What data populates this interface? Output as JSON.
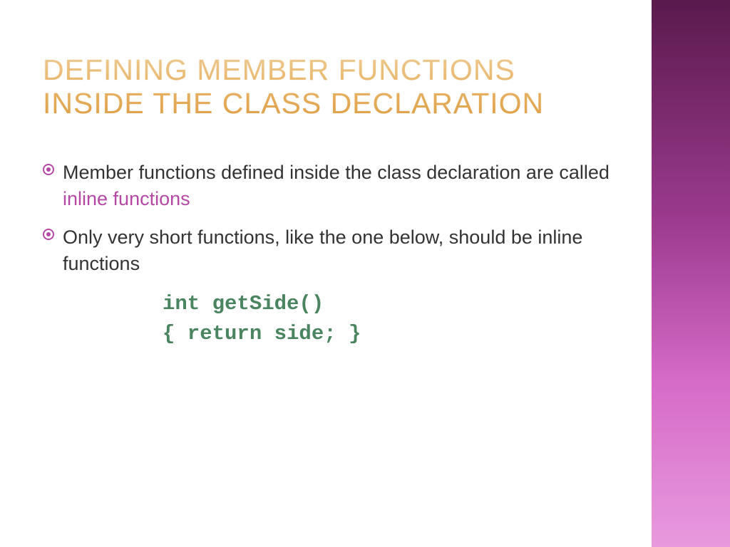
{
  "title": "DEFINING MEMBER FUNCTIONS INSIDE THE CLASS DECLARATION",
  "bullets": [
    {
      "text_pre": "Member functions defined inside the class declaration are called ",
      "highlight": "inline functions",
      "text_post": ""
    },
    {
      "text_pre": "Only very short functions, like the one below, should be inline functions",
      "highlight": "",
      "text_post": ""
    }
  ],
  "code": {
    "line1": "int getSide()",
    "line2": "{ return side; }"
  }
}
